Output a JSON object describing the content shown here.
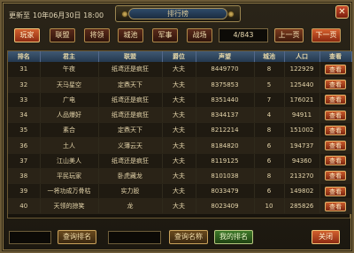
{
  "header": {
    "updated_label": "更新至",
    "updated_time": "10年06月30日 18:00",
    "title": "排行榜"
  },
  "categories": [
    {
      "label": "玩家",
      "active": true
    },
    {
      "label": "联盟",
      "active": false
    },
    {
      "label": "将领",
      "active": false
    },
    {
      "label": "城池",
      "active": false
    },
    {
      "label": "军事",
      "active": false
    },
    {
      "label": "战场",
      "active": false
    }
  ],
  "pagination": {
    "page_text": "4/843",
    "prev_label": "上一页",
    "next_label": "下一页"
  },
  "table": {
    "columns": [
      "排名",
      "君主",
      "联盟",
      "爵位",
      "声望",
      "城池",
      "人口",
      "查看"
    ],
    "view_label": "查看",
    "rows": [
      {
        "rank": "31",
        "lord": "午夜",
        "alliance": "纸鸢还是疯狂",
        "title": "大夫",
        "prestige": "8449770",
        "cities": "8",
        "population": "122929"
      },
      {
        "rank": "32",
        "lord": "天马星空",
        "alliance": "定鼎天下",
        "title": "大夫",
        "prestige": "8375853",
        "cities": "5",
        "population": "125440"
      },
      {
        "rank": "33",
        "lord": "广电",
        "alliance": "纸鸢还是疯狂",
        "title": "大夫",
        "prestige": "8351440",
        "cities": "7",
        "population": "176021"
      },
      {
        "rank": "34",
        "lord": "人品爆好",
        "alliance": "纸鸢还是疯狂",
        "title": "大夫",
        "prestige": "8344137",
        "cities": "4",
        "population": "94911"
      },
      {
        "rank": "35",
        "lord": "素合",
        "alliance": "定鼎天下",
        "title": "大夫",
        "prestige": "8212214",
        "cities": "8",
        "population": "151002"
      },
      {
        "rank": "36",
        "lord": "土人",
        "alliance": "义薄云天",
        "title": "大夫",
        "prestige": "8184820",
        "cities": "6",
        "population": "194737"
      },
      {
        "rank": "37",
        "lord": "江山美人",
        "alliance": "纸鸢还是疯狂",
        "title": "大夫",
        "prestige": "8119125",
        "cities": "6",
        "population": "94360"
      },
      {
        "rank": "38",
        "lord": "平民玩家",
        "alliance": "卧虎藏龙",
        "title": "大夫",
        "prestige": "8101038",
        "cities": "8",
        "population": "213270"
      },
      {
        "rank": "39",
        "lord": "一将功成万骨枯",
        "alliance": "实力股",
        "title": "大夫",
        "prestige": "8033479",
        "cities": "6",
        "population": "149802"
      },
      {
        "rank": "40",
        "lord": "天领的掠笑",
        "alliance": "龙",
        "title": "大夫",
        "prestige": "8023409",
        "cities": "10",
        "population": "285826"
      }
    ]
  },
  "footer": {
    "query_rank_label": "查询排名",
    "query_name_label": "查询名称",
    "my_rank_label": "我的排名",
    "close_label": "关闭"
  }
}
